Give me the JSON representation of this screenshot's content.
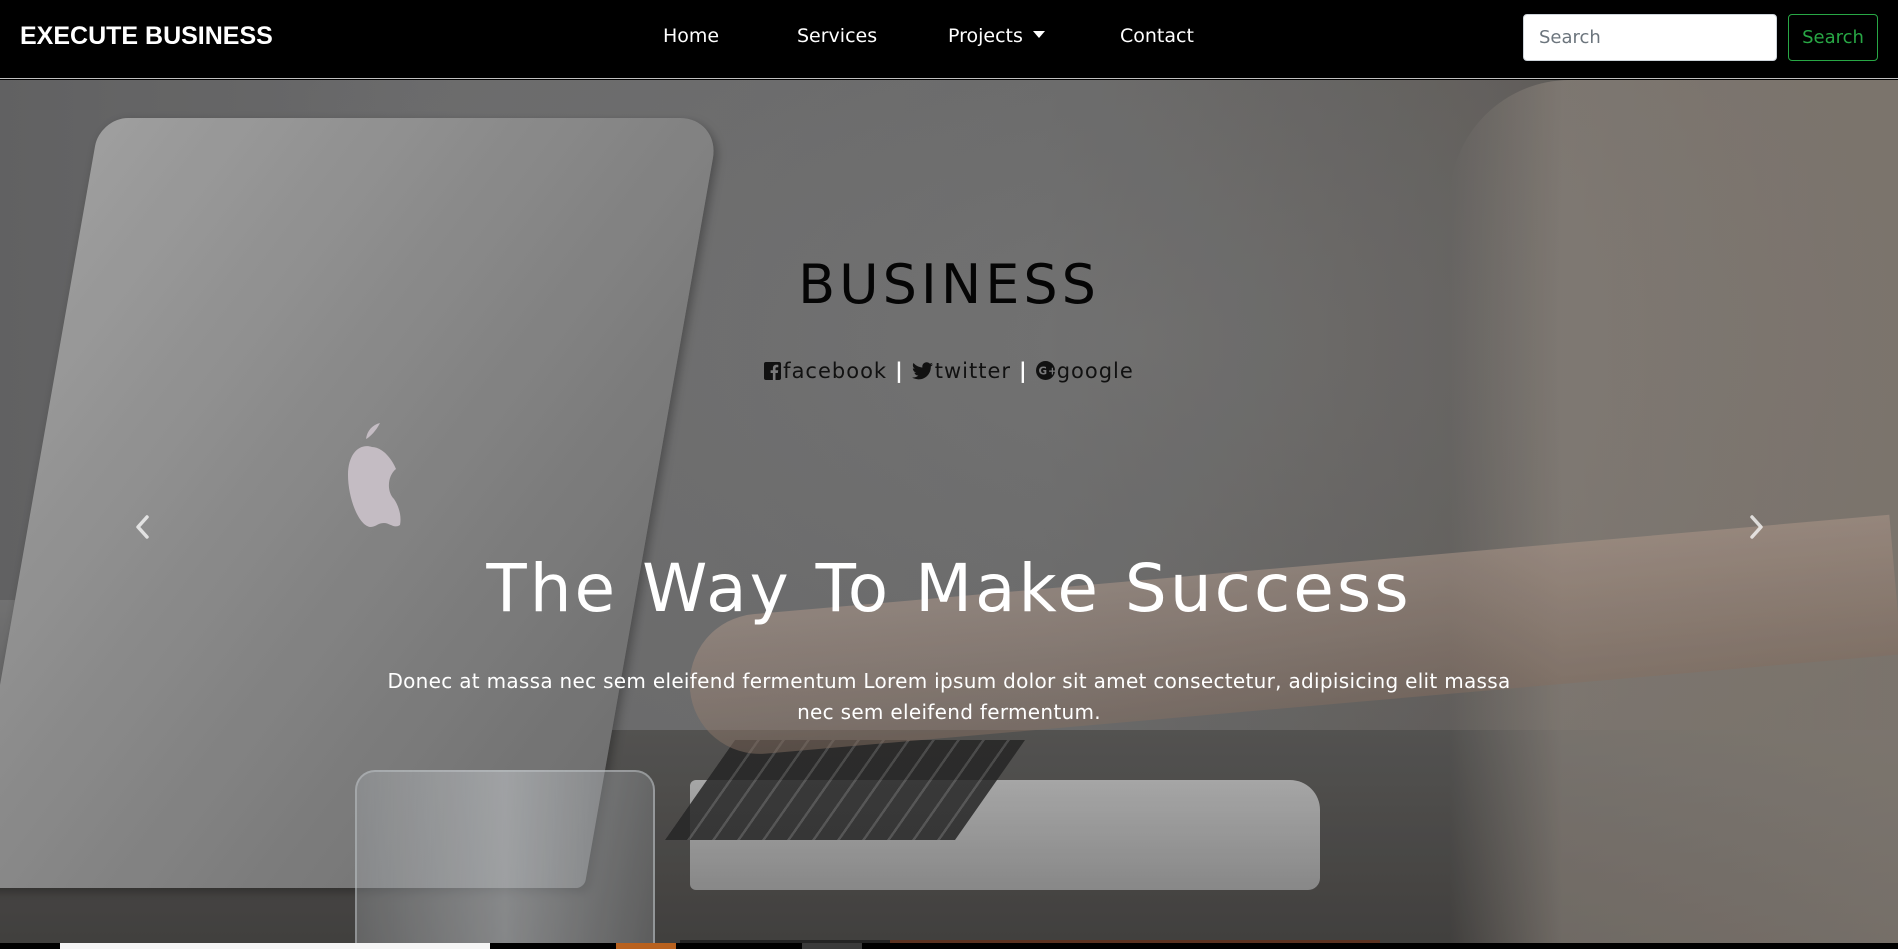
{
  "navbar": {
    "brand": "EXECUTE BUSINESS",
    "links": {
      "home": "Home",
      "services": "Services",
      "projects": "Projects",
      "contact": "Contact"
    },
    "search": {
      "placeholder": "Search",
      "value": "",
      "button_label": "Search"
    }
  },
  "hero": {
    "heading": "BUSINESS",
    "social": {
      "facebook": "facebook",
      "twitter": "twitter",
      "google": "google",
      "separator": "|"
    },
    "title": "The Way To Make Success",
    "description": "Donec at massa nec sem eleifend fermentum Lorem ipsum dolor sit amet consectetur, adipisicing elit massa nec sem eleifend fermentum."
  },
  "icons": {
    "carousel_prev": "chevron-left-icon",
    "carousel_next": "chevron-right-icon",
    "projects_dropdown": "caret-down-icon",
    "facebook": "facebook-icon",
    "twitter": "twitter-icon",
    "google": "google-plus-icon"
  },
  "colors": {
    "navbar_bg": "#000000",
    "search_button": "#28a745",
    "hero_text": "#ffffff",
    "heading_text": "#050505"
  },
  "carousel": {
    "active_index": 0
  }
}
